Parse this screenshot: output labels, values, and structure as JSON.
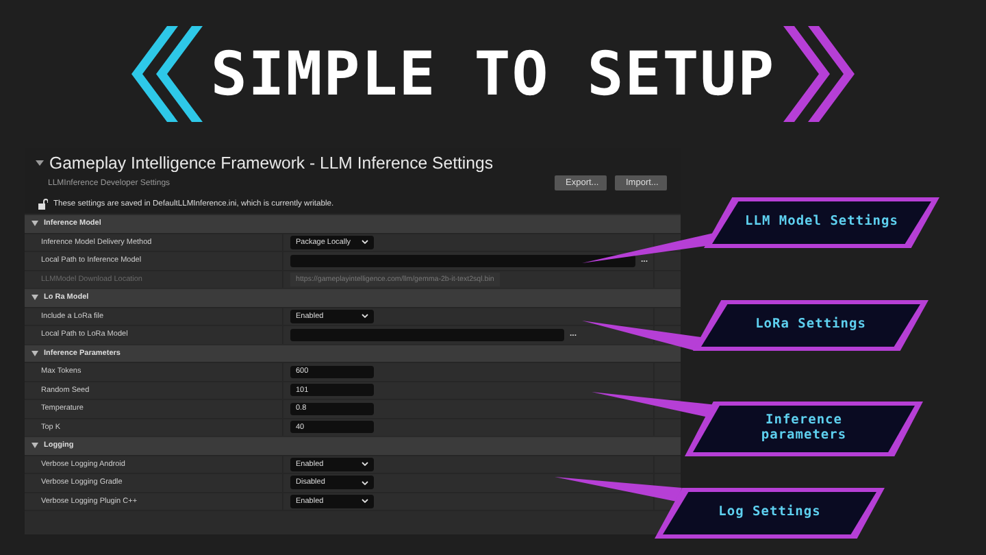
{
  "banner": {
    "title": "SIMPLE TO SETUP"
  },
  "panel": {
    "title": "Gameplay Intelligence Framework - LLM Inference Settings",
    "subtitle": "LLMInference Developer Settings",
    "buttons": [
      "Export...",
      "Import..."
    ],
    "notice": "These settings are saved in DefaultLLMInference.ini, which is currently writable.",
    "sections": [
      {
        "title": "Inference Model",
        "expanded": true,
        "rows": [
          {
            "label": "Inference Model Delivery Method",
            "kind": "dropdown",
            "value": "Package Locally",
            "disabled": false
          },
          {
            "label": "Local Path to Inference Model",
            "kind": "path",
            "browse": "...",
            "disabled": false
          },
          {
            "label": "LLMModel Download Location",
            "kind": "readonly",
            "value": "https://gameplayintelligence.com/llm/gemma-2b-it-text2sql.bin",
            "disabled": true
          }
        ]
      },
      {
        "title": "Lo Ra Model",
        "expanded": true,
        "rows": [
          {
            "label": "Include a LoRa file",
            "kind": "dropdown",
            "value": "Enabled",
            "disabled": false
          },
          {
            "label": "Local Path to LoRa Model",
            "kind": "path",
            "browse": "...",
            "disabled": false
          }
        ]
      },
      {
        "title": "Inference Parameters",
        "expanded": true,
        "rows": [
          {
            "label": "Max Tokens",
            "kind": "text",
            "value": "600",
            "disabled": false
          },
          {
            "label": "Random Seed",
            "kind": "text",
            "value": "101",
            "disabled": false
          },
          {
            "label": "Temperature",
            "kind": "text",
            "value": "0.8",
            "disabled": false
          },
          {
            "label": "Top K",
            "kind": "text",
            "value": "40",
            "disabled": false
          }
        ]
      },
      {
        "title": "Logging",
        "expanded": true,
        "rows": [
          {
            "label": "Verbose Logging Android",
            "kind": "dropdown",
            "value": "Enabled",
            "disabled": false
          },
          {
            "label": "Verbose Logging Gradle",
            "kind": "dropdown",
            "value": "Disabled",
            "disabled": false
          },
          {
            "label": "Verbose Logging Plugin C++",
            "kind": "dropdown",
            "value": "Enabled",
            "disabled": false
          }
        ]
      }
    ]
  },
  "callouts": [
    {
      "text": "LLM Model Settings"
    },
    {
      "text": "LoRa Settings"
    },
    {
      "text": "Inference parameters"
    },
    {
      "text": "Log Settings"
    }
  ]
}
